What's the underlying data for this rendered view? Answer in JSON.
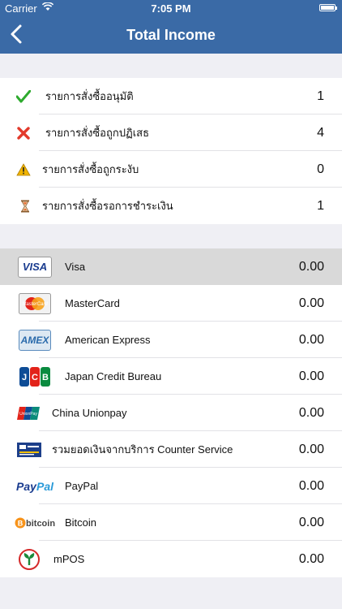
{
  "statusbar": {
    "carrier": "Carrier",
    "time": "7:05 PM"
  },
  "navbar": {
    "title": "Total Income",
    "back_icon": "chevron-left-icon"
  },
  "order_statuses": [
    {
      "label": "รายการสั่งซื้ออนุมัติ",
      "count": "1",
      "icon": "checkmark-icon",
      "color": "#2eaa2e"
    },
    {
      "label": "รายการสั่งซื้อถูกปฏิเสธ",
      "count": "4",
      "icon": "cross-icon",
      "color": "#e23a2b"
    },
    {
      "label": "รายการสั่งซื้อถูกระงับ",
      "count": "0",
      "icon": "warning-icon",
      "color": "#f0b400"
    },
    {
      "label": "รายการสั่งซื้อรอการชำระเงิน",
      "count": "1",
      "icon": "hourglass-icon",
      "color": "#c77a2a"
    }
  ],
  "payment_methods": [
    {
      "name": "Visa",
      "amount": "0.00",
      "logo": "visa-logo",
      "logo_text": "VISA",
      "selected": true
    },
    {
      "name": "MasterCard",
      "amount": "0.00",
      "logo": "mastercard-logo",
      "logo_text": "MasterCard"
    },
    {
      "name": "American Express",
      "amount": "0.00",
      "logo": "amex-logo",
      "logo_text": "AMEX"
    },
    {
      "name": "Japan Credit Bureau",
      "amount": "0.00",
      "logo": "jcb-logo",
      "logo_text": "JCB"
    },
    {
      "name": "China Unionpay",
      "amount": "0.00",
      "logo": "unionpay-logo",
      "logo_text": "UnionPay"
    },
    {
      "name": "รวมยอดเงินจากบริการ Counter Service",
      "amount": "0.00",
      "logo": "counter-service-logo",
      "logo_text": ""
    },
    {
      "name": "PayPal",
      "amount": "0.00",
      "logo": "paypal-logo",
      "logo_text": "PayPal"
    },
    {
      "name": "Bitcoin",
      "amount": "0.00",
      "logo": "bitcoin-logo",
      "logo_text": "bitcoin"
    },
    {
      "name": "mPOS",
      "amount": "0.00",
      "logo": "kbank-mpos-logo",
      "logo_text": ""
    }
  ]
}
